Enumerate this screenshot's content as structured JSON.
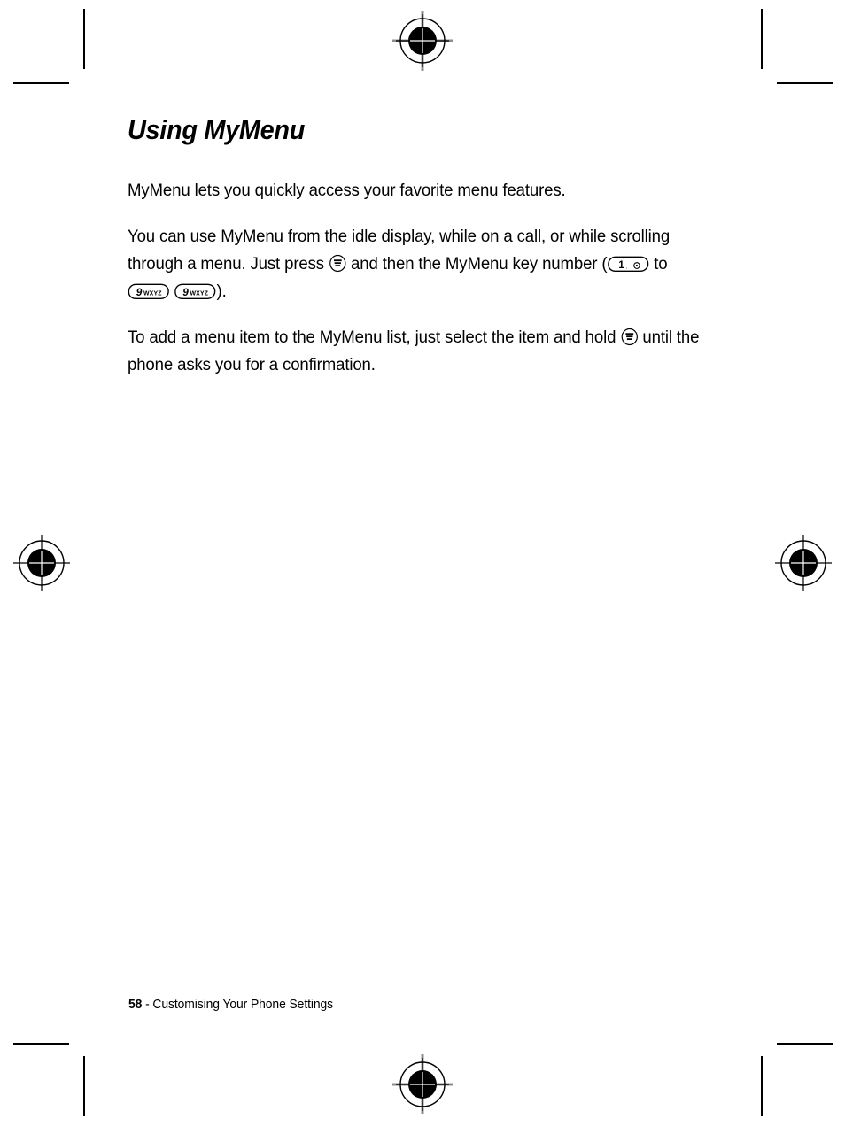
{
  "document": {
    "title": "Using MyMenu",
    "paragraphs": [
      {
        "id": "intro",
        "text": "MyMenu lets you quickly access your favorite menu features."
      },
      {
        "id": "usage",
        "segments": [
          "You can use MyMenu from the idle display, while on a call, or while scrolling through a menu. Just press ",
          " and then the MyMenu key number (",
          " to ",
          " ",
          ")."
        ],
        "full_text": "You can use MyMenu from the idle display, while on a call, or while scrolling through a menu. Just press [menu-key] and then the MyMenu key number ([key-1] to [key-9] [key-9])."
      },
      {
        "id": "add-item",
        "segments": [
          "To add a menu item to the MyMenu list, just select the item and hold ",
          " until the phone asks you for a confirmation."
        ],
        "full_text": "To add a menu item to the MyMenu list, just select the item and hold [menu-key] until the phone asks you for a confirmation."
      }
    ]
  },
  "keys": {
    "menu": {
      "name": "menu-key-icon",
      "label": "Menu key",
      "shape": "circle",
      "glyph": "three-bars"
    },
    "one": {
      "name": "key-1-icon",
      "label": "1",
      "sublabel": "@",
      "shape": "oval"
    },
    "nine": {
      "name": "key-9-icon",
      "label": "9",
      "sublabel": "WXYZ",
      "shape": "oval"
    }
  },
  "footer": {
    "page_number": "58",
    "separator": " - ",
    "section": "Customising Your Phone Settings"
  },
  "print_marks": {
    "registration": [
      "top",
      "bottom",
      "left",
      "right"
    ],
    "crop": [
      "top-left",
      "top-right",
      "bottom-left",
      "bottom-right"
    ]
  },
  "colors": {
    "ink": "#000000",
    "paper": "#ffffff"
  }
}
